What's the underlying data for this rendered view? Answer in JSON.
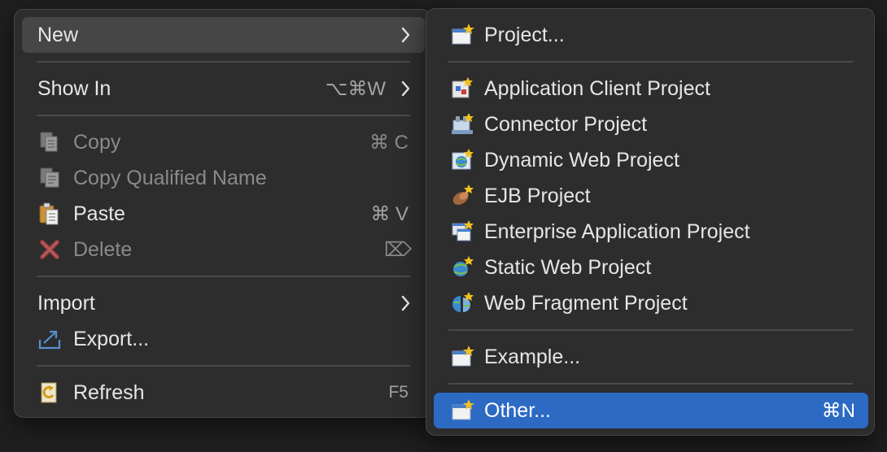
{
  "main_menu": {
    "new": {
      "label": "New"
    },
    "show_in": {
      "label": "Show In",
      "shortcut": "⌥⌘W"
    },
    "copy": {
      "label": "Copy",
      "shortcut": "⌘ C",
      "icon": "copy-icon"
    },
    "copy_qualified": {
      "label": "Copy Qualified Name",
      "icon": "copy-qualified-name-icon"
    },
    "paste": {
      "label": "Paste",
      "shortcut": "⌘ V",
      "icon": "paste-icon"
    },
    "delete": {
      "label": "Delete",
      "shortcut": "⌦",
      "icon": "delete-icon"
    },
    "import": {
      "label": "Import"
    },
    "export": {
      "label": "Export...",
      "icon": "export-icon"
    },
    "refresh": {
      "label": "Refresh",
      "shortcut": "F5",
      "icon": "refresh-icon"
    }
  },
  "sub_menu": {
    "project": {
      "label": "Project...",
      "icon": "new-project-icon"
    },
    "app_client": {
      "label": "Application Client Project",
      "icon": "app-client-project-icon"
    },
    "connector": {
      "label": "Connector Project",
      "icon": "connector-project-icon"
    },
    "dynamic_web": {
      "label": "Dynamic Web Project",
      "icon": "dynamic-web-project-icon"
    },
    "ejb": {
      "label": "EJB Project",
      "icon": "ejb-project-icon"
    },
    "enterprise": {
      "label": "Enterprise Application Project",
      "icon": "enterprise-app-project-icon"
    },
    "static_web": {
      "label": "Static Web Project",
      "icon": "static-web-project-icon"
    },
    "web_fragment": {
      "label": "Web Fragment Project",
      "icon": "web-fragment-project-icon"
    },
    "example": {
      "label": "Example...",
      "icon": "example-icon"
    },
    "other": {
      "label": "Other...",
      "shortcut": "⌘N",
      "icon": "other-wizard-icon"
    }
  },
  "colors": {
    "menu_bg": "#2d2d2e",
    "hover_bg": "#464647",
    "selected_bg": "#2c6ac4",
    "text": "#e6e6e6",
    "disabled_text": "#8a8a8c"
  }
}
